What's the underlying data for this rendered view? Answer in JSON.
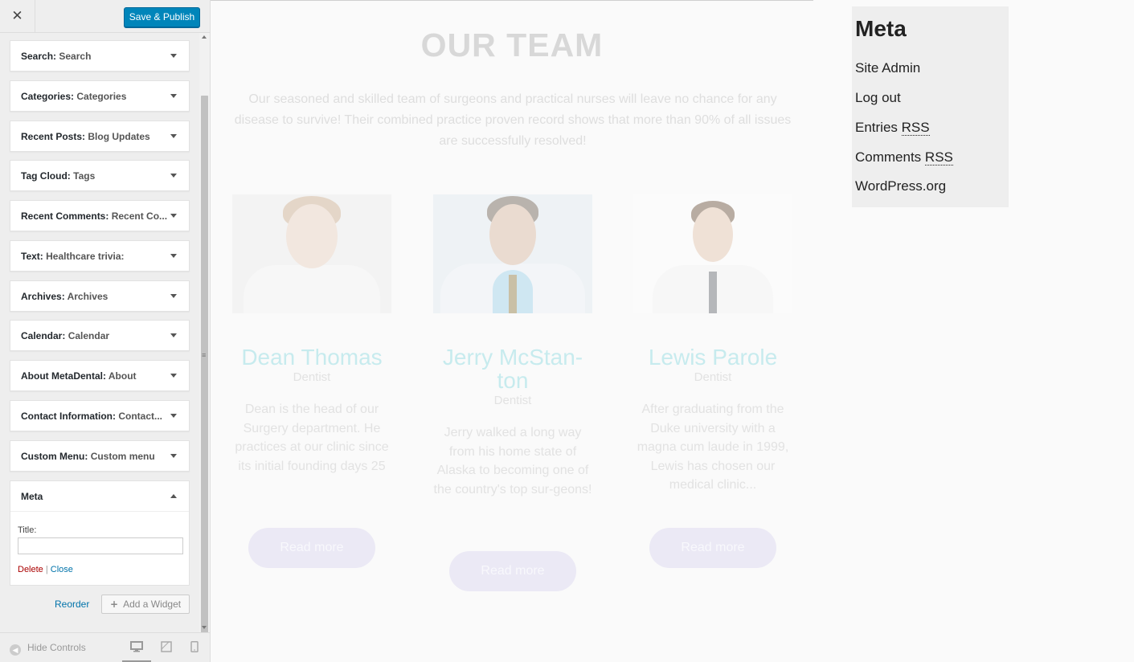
{
  "panel": {
    "close_glyph": "✕",
    "publish_label": "Save & Publish",
    "widgets": [
      {
        "type": "Search",
        "instance": "Search"
      },
      {
        "type": "Categories",
        "instance": "Categories"
      },
      {
        "type": "Recent Posts",
        "instance": "Blog Updates"
      },
      {
        "type": "Tag Cloud",
        "instance": "Tags"
      },
      {
        "type": "Recent Comments",
        "instance": "Recent Co..."
      },
      {
        "type": "Text",
        "instance": "Healthcare trivia:"
      },
      {
        "type": "Archives",
        "instance": "Archives"
      },
      {
        "type": "Calendar",
        "instance": "Calendar"
      },
      {
        "type": "About MetaDental",
        "instance": "About"
      },
      {
        "type": "Contact Information",
        "instance": "Contact..."
      },
      {
        "type": "Custom Menu",
        "instance": "Custom menu"
      }
    ],
    "open_widget": {
      "type": "Meta",
      "title_label": "Title:",
      "title_value": "",
      "delete_label": "Delete",
      "separator": "|",
      "close_label": "Close"
    },
    "reorder_label": "Reorder",
    "add_widget_label": "Add a Widget",
    "footer": {
      "hide_controls_label": "Hide Controls"
    }
  },
  "preview": {
    "team_title": "OUR TEAM",
    "team_intro": "Our seasoned and skilled team of surgeons and practical nurses will leave no chance for any disease to survive! Their combined practice proven record shows that more than 90% of all issues are successfully resolved!",
    "members": [
      {
        "name": "Dean Thomas",
        "role": "Dentist",
        "bio": "Dean is the head of our Surgery department. He practices at our clinic since its initial founding days 25",
        "button": "Read more"
      },
      {
        "name": "Jerry McStan-ton",
        "role": "Dentist",
        "bio": "Jerry walked a long way from his home state of Alaska to becoming one of the country's top sur-geons!",
        "button": "Read more"
      },
      {
        "name": "Lewis Parole",
        "role": "Dentist",
        "bio": "After graduating from the Duke university with a magna cum laude in 1999, Lewis has chosen our medical clinic...",
        "button": "Read more"
      }
    ],
    "meta_widget": {
      "heading": "Meta",
      "links": [
        {
          "text": "Site Admin"
        },
        {
          "text": "Log out"
        },
        {
          "text": "Entries ",
          "abbr": "RSS"
        },
        {
          "text": "Comments ",
          "abbr": "RSS"
        },
        {
          "text": "WordPress.org"
        }
      ]
    }
  },
  "colors": {
    "publish_bg": "#0085ba",
    "delete_link": "#a00",
    "link": "#0073aa",
    "member_name": "#c7ebee",
    "read_more_bg": "#ebe9f5"
  }
}
